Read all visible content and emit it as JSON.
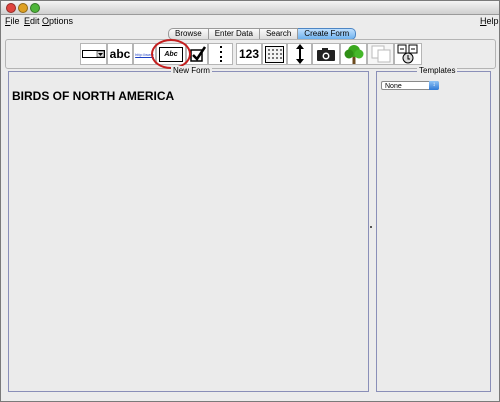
{
  "menu": {
    "file": {
      "first": "F",
      "rest": "ile"
    },
    "edit": {
      "first": "E",
      "rest": "dit"
    },
    "options": {
      "first": "O",
      "rest": "ptions"
    },
    "help": {
      "first": "H",
      "rest": "elp"
    }
  },
  "tabs": [
    {
      "label": "Browse",
      "active": false
    },
    {
      "label": "Enter Data",
      "active": false
    },
    {
      "label": "Search",
      "active": false
    },
    {
      "label": "Create Form",
      "active": true
    }
  ],
  "toolbar": {
    "items": [
      {
        "icon": "dropdown-field-icon"
      },
      {
        "icon": "text-field-icon",
        "text": "abc"
      },
      {
        "icon": "url-field-icon",
        "text": "http://www"
      },
      {
        "icon": "label-field-icon",
        "text": "Abc"
      },
      {
        "icon": "checkbox-field-icon"
      },
      {
        "icon": "separator-icon"
      },
      {
        "icon": "number-field-icon",
        "text": "123"
      },
      {
        "icon": "date-field-icon"
      },
      {
        "icon": "spacer-icon"
      },
      {
        "icon": "camera-icon"
      },
      {
        "icon": "tree-icon"
      },
      {
        "icon": "duplicate-icon"
      },
      {
        "icon": "form-properties-icon"
      }
    ]
  },
  "new_form": {
    "title": "New Form",
    "form_heading": "BIRDS OF NORTH AMERICA"
  },
  "templates": {
    "title": "Templates",
    "selected": "None"
  },
  "colors": {
    "accent": "#6fb2ee",
    "highlight_circle": "#c41f1f",
    "panel_border": "#8a8fb8"
  }
}
